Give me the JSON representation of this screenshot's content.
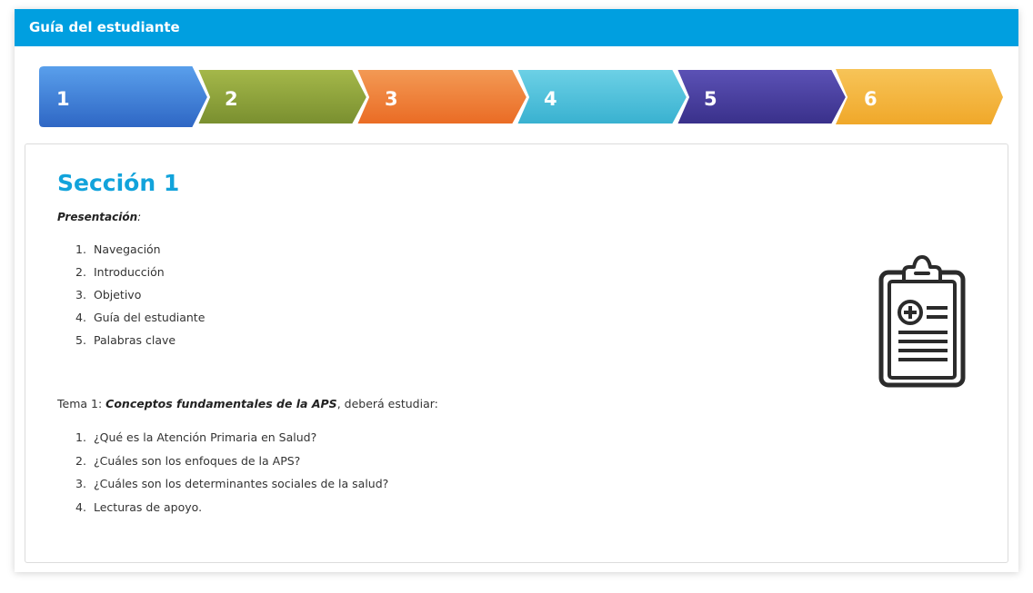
{
  "header": {
    "title": "Guía del estudiante"
  },
  "tabs": [
    {
      "label": "1",
      "color": "#3a7ad6",
      "active": true
    },
    {
      "label": "2",
      "color": "#8ca33c"
    },
    {
      "label": "3",
      "color": "#ee7e35"
    },
    {
      "label": "4",
      "color": "#4fc2db"
    },
    {
      "label": "5",
      "color": "#453c9c"
    },
    {
      "label": "6",
      "color": "#f3b63a"
    }
  ],
  "section": {
    "title": "Sección 1",
    "presentation_label": "Presentación",
    "presentation_suffix": ":",
    "items": [
      {
        "num": "1.",
        "text": "Navegación"
      },
      {
        "num": "2.",
        "text": "Introducción"
      },
      {
        "num": "3.",
        "text": "Objetivo"
      },
      {
        "num": "4.",
        "text": "Guía del estudiante"
      },
      {
        "num": "5.",
        "text": "Palabras clave"
      }
    ],
    "topic": {
      "prefix": "Tema 1: ",
      "title": "Conceptos fundamentales de la APS",
      "suffix": ", deberá estudiar:"
    },
    "topic_items": [
      {
        "num": "1.",
        "text": "¿Qué es la Atención Primaria en Salud?"
      },
      {
        "num": "2.",
        "text": "¿Cuáles son los enfoques de la APS?"
      },
      {
        "num": "3.",
        "text": "¿Cuáles son los determinantes sociales de la salud?"
      },
      {
        "num": "4.",
        "text": "Lecturas de apoyo."
      }
    ],
    "icon": "clipboard-medical-icon"
  }
}
